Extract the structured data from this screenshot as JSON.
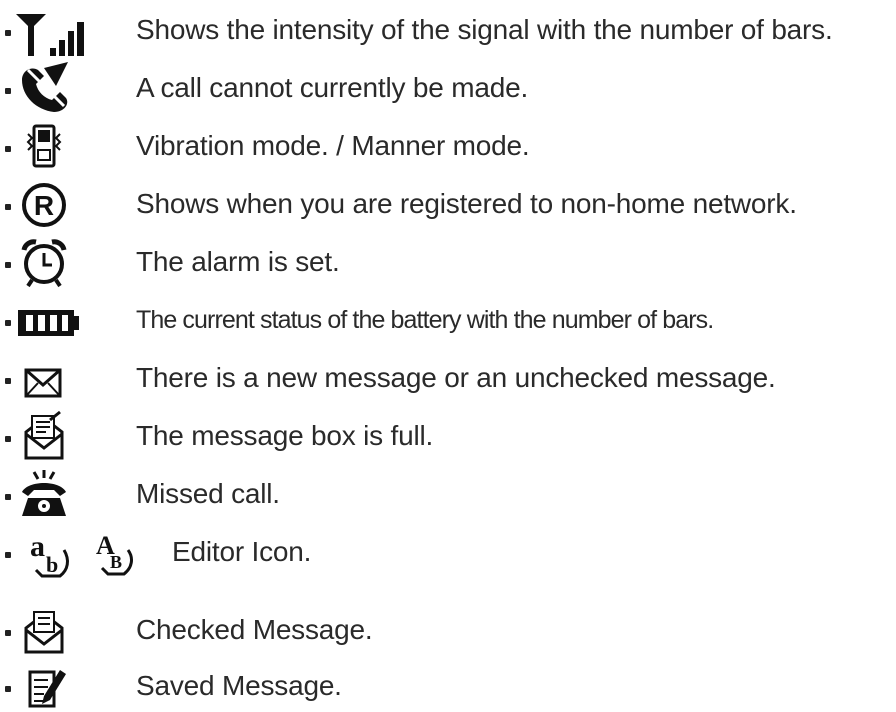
{
  "items": [
    {
      "icon": "signal-strength-icon",
      "text": "Shows the intensity of the signal with the number of bars."
    },
    {
      "icon": "no-call-icon",
      "text": "A call cannot currently be made."
    },
    {
      "icon": "vibration-icon",
      "text": "Vibration mode. / Manner mode."
    },
    {
      "icon": "roaming-icon",
      "text": "Shows when you are registered to non-home network."
    },
    {
      "icon": "alarm-clock-icon",
      "text": "The alarm is set."
    },
    {
      "icon": "battery-icon",
      "text": "The current status of the battery with the number of bars."
    },
    {
      "icon": "envelope-icon",
      "text": "There is a new message or an unchecked message."
    },
    {
      "icon": "message-box-full-icon",
      "text": "The message box is full."
    },
    {
      "icon": "missed-call-icon",
      "text": "Missed call."
    },
    {
      "icon": "editor-icon",
      "text": "Editor Icon."
    },
    {
      "icon": "checked-message-icon",
      "text": "Checked Message."
    },
    {
      "icon": "saved-message-icon",
      "text": "Saved Message."
    }
  ],
  "editor_glyphs": {
    "lower": "a",
    "lower_sub": "b",
    "upper": "A",
    "upper_sub": "B"
  },
  "roaming_letter": "R"
}
